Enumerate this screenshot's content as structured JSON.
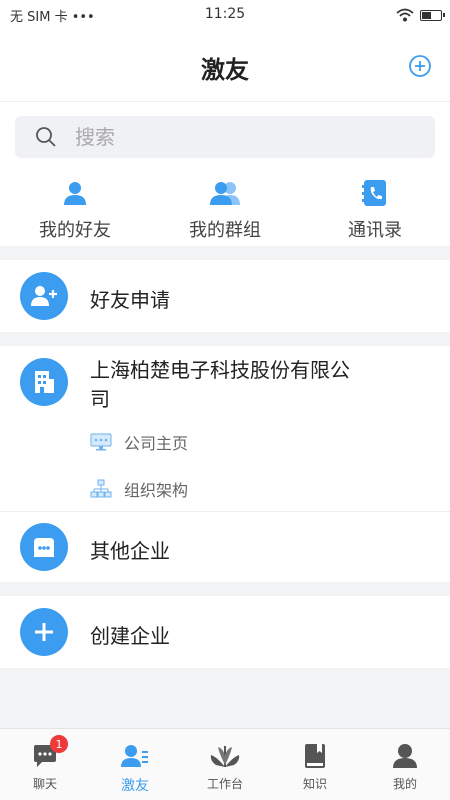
{
  "status_bar": {
    "carrier": "无 SIM 卡 •••",
    "time": "11:25"
  },
  "header": {
    "title": "激友"
  },
  "search": {
    "placeholder": "搜索"
  },
  "quick_actions": [
    {
      "label": "我的好友",
      "icon": "person-icon"
    },
    {
      "label": "我的群组",
      "icon": "group-icon"
    },
    {
      "label": "通讯录",
      "icon": "phonebook-icon"
    }
  ],
  "friend_request": {
    "label": "好友申请"
  },
  "company": {
    "name_line1": "上海柏楚电子科技股份有限公",
    "name_line2": "司",
    "home_label": "公司主页",
    "org_label": "组织架构"
  },
  "other_enterprise": {
    "label": "其他企业"
  },
  "create_enterprise": {
    "label": "创建企业"
  },
  "tabbar": {
    "chat": {
      "label": "聊天",
      "badge": "1"
    },
    "contacts": {
      "label": "激友"
    },
    "workbench": {
      "label": "工作台"
    },
    "knowledge": {
      "label": "知识"
    },
    "me": {
      "label": "我的"
    }
  },
  "colors": {
    "accent": "#3c9cf0",
    "badge": "#ef3a3a"
  }
}
